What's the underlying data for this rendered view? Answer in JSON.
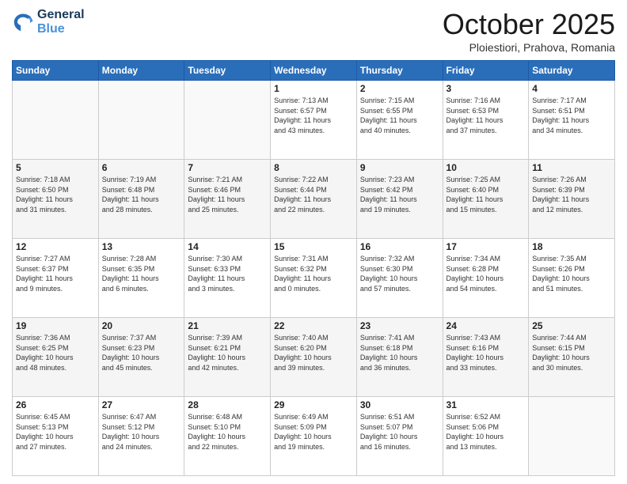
{
  "header": {
    "logo_line1": "General",
    "logo_line2": "Blue",
    "month": "October 2025",
    "location": "Ploiestiori, Prahova, Romania"
  },
  "days_of_week": [
    "Sunday",
    "Monday",
    "Tuesday",
    "Wednesday",
    "Thursday",
    "Friday",
    "Saturday"
  ],
  "weeks": [
    [
      {
        "day": "",
        "info": ""
      },
      {
        "day": "",
        "info": ""
      },
      {
        "day": "",
        "info": ""
      },
      {
        "day": "1",
        "info": "Sunrise: 7:13 AM\nSunset: 6:57 PM\nDaylight: 11 hours\nand 43 minutes."
      },
      {
        "day": "2",
        "info": "Sunrise: 7:15 AM\nSunset: 6:55 PM\nDaylight: 11 hours\nand 40 minutes."
      },
      {
        "day": "3",
        "info": "Sunrise: 7:16 AM\nSunset: 6:53 PM\nDaylight: 11 hours\nand 37 minutes."
      },
      {
        "day": "4",
        "info": "Sunrise: 7:17 AM\nSunset: 6:51 PM\nDaylight: 11 hours\nand 34 minutes."
      }
    ],
    [
      {
        "day": "5",
        "info": "Sunrise: 7:18 AM\nSunset: 6:50 PM\nDaylight: 11 hours\nand 31 minutes."
      },
      {
        "day": "6",
        "info": "Sunrise: 7:19 AM\nSunset: 6:48 PM\nDaylight: 11 hours\nand 28 minutes."
      },
      {
        "day": "7",
        "info": "Sunrise: 7:21 AM\nSunset: 6:46 PM\nDaylight: 11 hours\nand 25 minutes."
      },
      {
        "day": "8",
        "info": "Sunrise: 7:22 AM\nSunset: 6:44 PM\nDaylight: 11 hours\nand 22 minutes."
      },
      {
        "day": "9",
        "info": "Sunrise: 7:23 AM\nSunset: 6:42 PM\nDaylight: 11 hours\nand 19 minutes."
      },
      {
        "day": "10",
        "info": "Sunrise: 7:25 AM\nSunset: 6:40 PM\nDaylight: 11 hours\nand 15 minutes."
      },
      {
        "day": "11",
        "info": "Sunrise: 7:26 AM\nSunset: 6:39 PM\nDaylight: 11 hours\nand 12 minutes."
      }
    ],
    [
      {
        "day": "12",
        "info": "Sunrise: 7:27 AM\nSunset: 6:37 PM\nDaylight: 11 hours\nand 9 minutes."
      },
      {
        "day": "13",
        "info": "Sunrise: 7:28 AM\nSunset: 6:35 PM\nDaylight: 11 hours\nand 6 minutes."
      },
      {
        "day": "14",
        "info": "Sunrise: 7:30 AM\nSunset: 6:33 PM\nDaylight: 11 hours\nand 3 minutes."
      },
      {
        "day": "15",
        "info": "Sunrise: 7:31 AM\nSunset: 6:32 PM\nDaylight: 11 hours\nand 0 minutes."
      },
      {
        "day": "16",
        "info": "Sunrise: 7:32 AM\nSunset: 6:30 PM\nDaylight: 10 hours\nand 57 minutes."
      },
      {
        "day": "17",
        "info": "Sunrise: 7:34 AM\nSunset: 6:28 PM\nDaylight: 10 hours\nand 54 minutes."
      },
      {
        "day": "18",
        "info": "Sunrise: 7:35 AM\nSunset: 6:26 PM\nDaylight: 10 hours\nand 51 minutes."
      }
    ],
    [
      {
        "day": "19",
        "info": "Sunrise: 7:36 AM\nSunset: 6:25 PM\nDaylight: 10 hours\nand 48 minutes."
      },
      {
        "day": "20",
        "info": "Sunrise: 7:37 AM\nSunset: 6:23 PM\nDaylight: 10 hours\nand 45 minutes."
      },
      {
        "day": "21",
        "info": "Sunrise: 7:39 AM\nSunset: 6:21 PM\nDaylight: 10 hours\nand 42 minutes."
      },
      {
        "day": "22",
        "info": "Sunrise: 7:40 AM\nSunset: 6:20 PM\nDaylight: 10 hours\nand 39 minutes."
      },
      {
        "day": "23",
        "info": "Sunrise: 7:41 AM\nSunset: 6:18 PM\nDaylight: 10 hours\nand 36 minutes."
      },
      {
        "day": "24",
        "info": "Sunrise: 7:43 AM\nSunset: 6:16 PM\nDaylight: 10 hours\nand 33 minutes."
      },
      {
        "day": "25",
        "info": "Sunrise: 7:44 AM\nSunset: 6:15 PM\nDaylight: 10 hours\nand 30 minutes."
      }
    ],
    [
      {
        "day": "26",
        "info": "Sunrise: 6:45 AM\nSunset: 5:13 PM\nDaylight: 10 hours\nand 27 minutes."
      },
      {
        "day": "27",
        "info": "Sunrise: 6:47 AM\nSunset: 5:12 PM\nDaylight: 10 hours\nand 24 minutes."
      },
      {
        "day": "28",
        "info": "Sunrise: 6:48 AM\nSunset: 5:10 PM\nDaylight: 10 hours\nand 22 minutes."
      },
      {
        "day": "29",
        "info": "Sunrise: 6:49 AM\nSunset: 5:09 PM\nDaylight: 10 hours\nand 19 minutes."
      },
      {
        "day": "30",
        "info": "Sunrise: 6:51 AM\nSunset: 5:07 PM\nDaylight: 10 hours\nand 16 minutes."
      },
      {
        "day": "31",
        "info": "Sunrise: 6:52 AM\nSunset: 5:06 PM\nDaylight: 10 hours\nand 13 minutes."
      },
      {
        "day": "",
        "info": ""
      }
    ]
  ]
}
